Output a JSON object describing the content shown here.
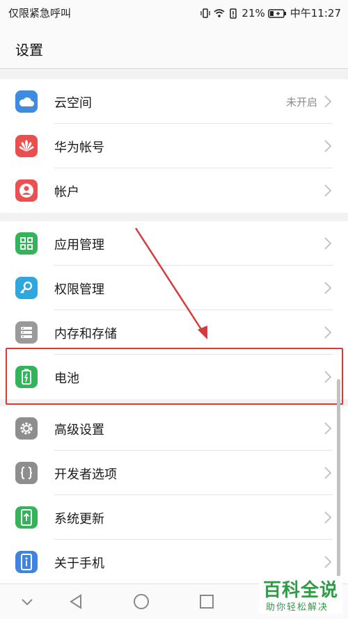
{
  "status_bar": {
    "carrier": "仅限紧急呼叫",
    "battery_percent": "21%",
    "time": "中午11:27"
  },
  "header": {
    "title": "设置"
  },
  "groups": [
    {
      "items": [
        {
          "label": "云空间",
          "value": "未开启",
          "icon": "cloud-icon",
          "color": "#3e8ce0"
        },
        {
          "label": "华为帐号",
          "icon": "huawei-logo-icon",
          "color": "#e94f4f"
        },
        {
          "label": "帐户",
          "icon": "account-icon",
          "color": "#e95252"
        }
      ]
    },
    {
      "items": [
        {
          "label": "应用管理",
          "icon": "apps-grid-icon",
          "color": "#33b45a"
        },
        {
          "label": "权限管理",
          "icon": "key-icon",
          "color": "#2ea6de"
        },
        {
          "label": "内存和存储",
          "icon": "storage-icon",
          "color": "#9a9a9a"
        },
        {
          "label": "电池",
          "icon": "battery-icon",
          "color": "#33b45a"
        }
      ]
    },
    {
      "items": [
        {
          "label": "高级设置",
          "icon": "gear-icon",
          "color": "#8e8e8e"
        },
        {
          "label": "开发者选项",
          "icon": "braces-icon",
          "color": "#8e8e8e"
        },
        {
          "label": "系统更新",
          "icon": "system-update-icon",
          "color": "#33b45a"
        },
        {
          "label": "关于手机",
          "icon": "info-icon",
          "color": "#3f84e0"
        }
      ]
    }
  ],
  "watermark": {
    "title": "百科全说",
    "subtitle": "助你轻松解决"
  }
}
